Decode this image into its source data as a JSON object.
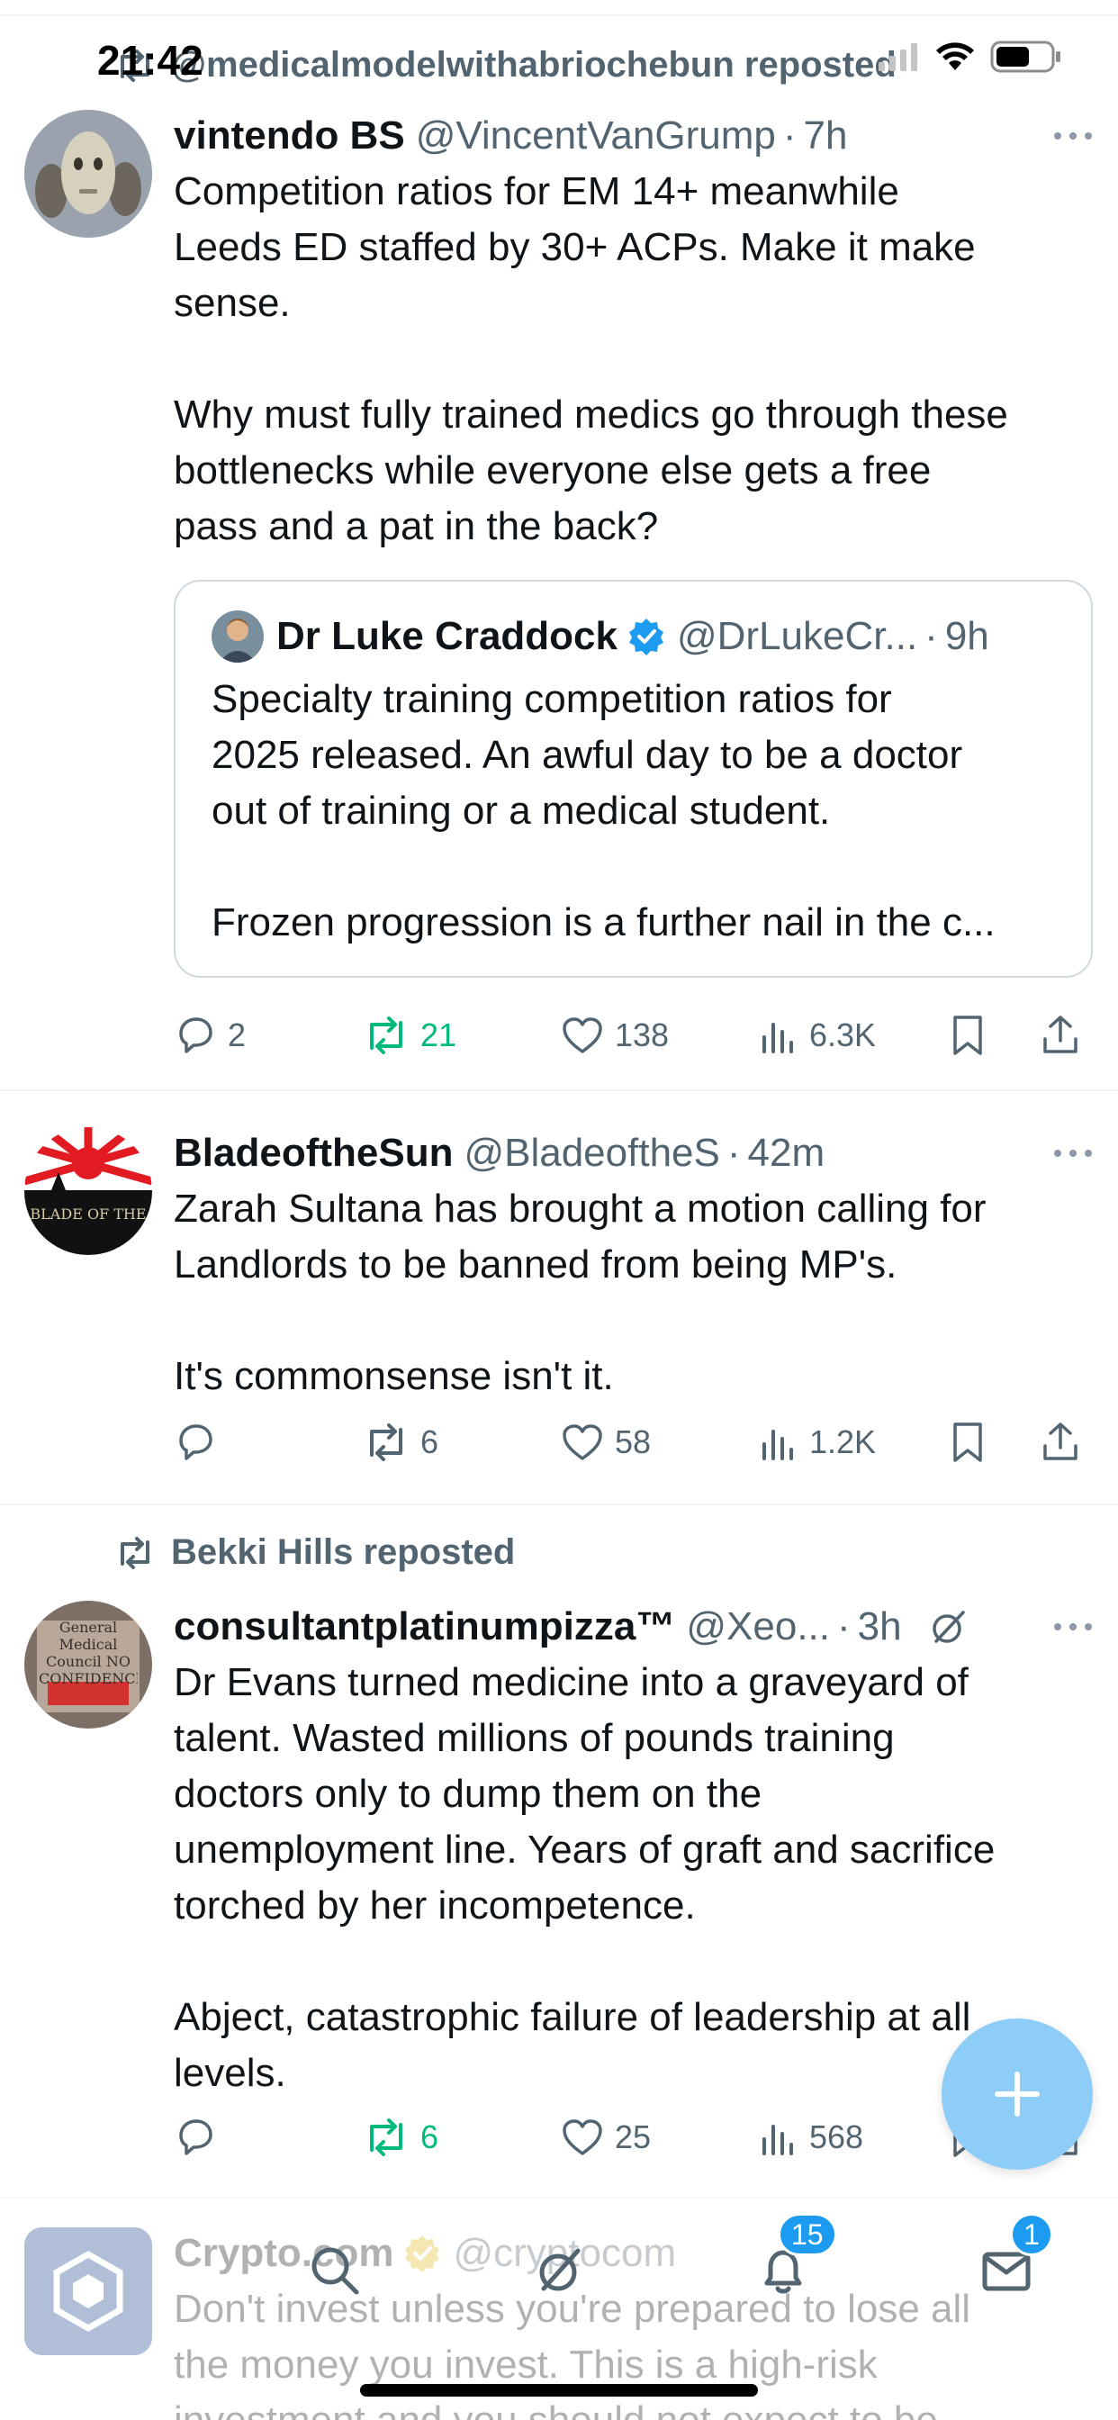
{
  "status_bar": {
    "time": "21:42"
  },
  "feed": {
    "tweets": [
      {
        "social_context": "@medicalmodelwithabriochebun reposted",
        "display_name": "vintendo BS",
        "handle": "@VincentVanGrump",
        "dot": "·",
        "time": "7h",
        "text": "Competition ratios for EM 14+ meanwhile\nLeeds ED staffed by 30+ ACPs. Make it make\nsense.\n\nWhy must fully trained medics go through these\nbottlenecks while everyone else gets a free\npass and a pat in the back?",
        "quote": {
          "display_name": "Dr Luke Craddock",
          "handle": "@DrLukeCr...",
          "dot": "·",
          "time": "9h",
          "text": "Specialty training competition ratios for\n2025 released. An awful day to be a doctor\nout of training or a medical student.\n\nFrozen progression is a further nail in the c..."
        },
        "replies": "2",
        "reposts": "21",
        "likes": "138",
        "views": "6.3K"
      },
      {
        "display_name": "BladeoftheSun",
        "handle": "@BladeoftheS",
        "dot": "·",
        "time": "42m",
        "avatar_text": "BLADE OF THE",
        "text": "Zarah Sultana has brought a motion calling for\nLandlords to be banned from being MP's.\n\nIt's commonsense isn't it.",
        "replies": "",
        "reposts": "6",
        "likes": "58",
        "views": "1.2K"
      },
      {
        "social_context": "Bekki Hills reposted",
        "display_name": "consultantplatinumpizza™",
        "handle": "@Xeo...",
        "dot": "·",
        "time": "3h",
        "avatar_text": "General Medical Council NO CONFIDENCE",
        "text": "Dr Evans turned medicine into a graveyard of\ntalent. Wasted millions of pounds training\ndoctors only to dump them on the\nunemployment line. Years of graft and sacrifice\ntorched by her incompetence.\n\nAbject, catastrophic failure of leadership at all\nlevels.",
        "replies": "",
        "reposts": "6",
        "likes": "25",
        "views": "568"
      },
      {
        "display_name": "Crypto.com",
        "handle": "@cryptocom",
        "text": "Don't invest unless you're prepared to lose all\nthe money you invest. This is a high-risk\ninvestment and you should not expect to be"
      }
    ]
  },
  "bottom_nav": {
    "notifications_badge": "15",
    "messages_badge": "1"
  },
  "colors": {
    "accent": "#1d9bf0",
    "repost_active": "#00ba7c",
    "secondary_text": "#536471",
    "fab": "#8ecdf7"
  }
}
